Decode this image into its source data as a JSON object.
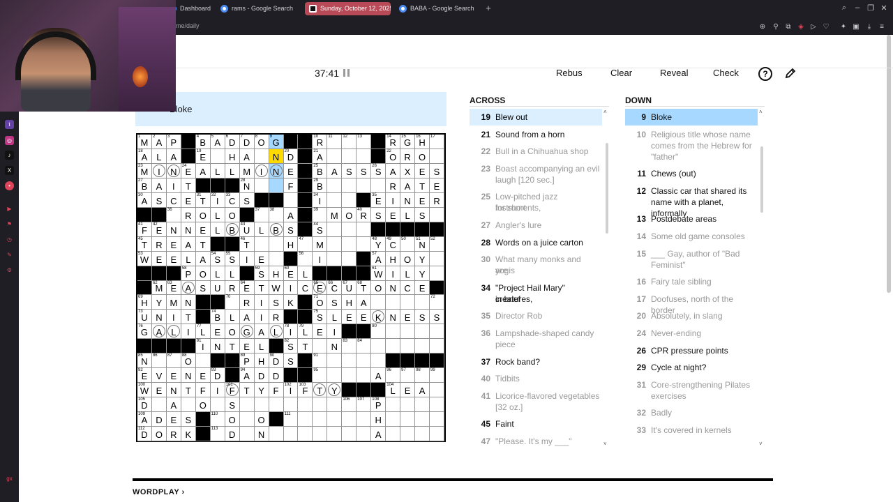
{
  "browser": {
    "tabs": [
      {
        "label": "Dashboard",
        "active": false
      },
      {
        "label": "rams - Google Search",
        "active": false
      },
      {
        "label": "Sunday, October 12, 2025",
        "active": true
      },
      {
        "label": "BABA - Google Search",
        "active": false
      }
    ],
    "url": "me/daily"
  },
  "toolbar": {
    "timer": "37:41",
    "rebus": "Rebus",
    "clear": "Clear",
    "reveal": "Reveal",
    "check": "Check",
    "help": "?"
  },
  "clue_bar": {
    "text": "Bloke"
  },
  "grid": {
    "rows": [
      "MAP#BADDOG##R##ARGH",
      "ALA#E.HA..D#A###TORO",
      "MINEALLMINE#BASSSAXES",
      "BAIT###N.F.B.....RATE",
      "ASCETICS##.I.#REINER",
      "##ROLO###A##MORSELS",
      "FENNELBULBS#S#####",
      "TREAT##T##H.M#.YC.N",
      "WEELASSIE.#.I..AHOY",
      "###POLL#SHEL##.WILY",
      "#MEASURETWICECUTONCE#",
      "HYMN##RISK#OSHA#",
      "UNIT#BLAIR##SLEEKNESS",
      "GALILEOGALILEI##",
      "####INTEL#ST..N.",
      "N..O###PHDS#......",
      "EVENED#ADD####A",
      "WENTFIFTYFIFTY##FLEA",
      "D..A..O..S.......P..",
      "ADES#.O..O....H.",
      "DORK#.D..N.......A.."
    ],
    "letters": [
      [
        "M",
        "A",
        "P",
        "#",
        "B",
        "A",
        "D",
        "D",
        "O",
        "G",
        "#",
        "#",
        "R",
        "",
        "",
        "#",
        "A",
        "R",
        "G",
        "H"
      ],
      [
        "A",
        "L",
        "A",
        "#",
        "E",
        "",
        "H",
        "A",
        "",
        "N",
        "D",
        "#",
        "A",
        "",
        "",
        "#",
        "T",
        "O",
        "R",
        "O"
      ],
      [
        "M",
        "I",
        "N",
        "E",
        "A",
        "L",
        "L",
        "M",
        "I",
        "N",
        "E",
        "#",
        "B",
        "A",
        "S",
        "S",
        "S",
        "A",
        "X",
        "E",
        "S"
      ],
      [
        "B",
        "A",
        "I",
        "T",
        "#",
        "#",
        "#",
        "N",
        "",
        "",
        "F",
        "",
        "B",
        "",
        "",
        "",
        "",
        "R",
        "A",
        "T",
        "E"
      ],
      [
        "A",
        "S",
        "C",
        "E",
        "T",
        "I",
        "C",
        "S",
        "#",
        "#",
        "",
        "#",
        "I",
        "",
        "#",
        "R",
        "E",
        "I",
        "N",
        "E",
        "R"
      ],
      [
        "#",
        "#",
        "",
        "R",
        "O",
        "L",
        "O",
        "#",
        "",
        "",
        "A",
        "#",
        "",
        "M",
        "O",
        "R",
        "S",
        "E",
        "L",
        "S",
        ""
      ],
      [
        "F",
        "E",
        "N",
        "N",
        "E",
        "L",
        "B",
        "U",
        "L",
        "B",
        "S",
        "#",
        "S",
        "",
        "",
        "#",
        "#",
        "#",
        "#",
        "#"
      ],
      [
        "T",
        "R",
        "E",
        "A",
        "T",
        "#",
        "#",
        "T",
        "",
        "",
        "H",
        "",
        "M",
        "",
        "",
        "",
        "Y",
        "C",
        "",
        "N"
      ],
      [
        "W",
        "E",
        "E",
        "L",
        "A",
        "S",
        "S",
        "I",
        "E",
        "",
        "#",
        "",
        "I",
        "",
        "",
        "#",
        "A",
        "H",
        "O",
        "Y"
      ],
      [
        "#",
        "#",
        "#",
        "P",
        "O",
        "L",
        "L",
        "#",
        "S",
        "H",
        "E",
        "L",
        "#",
        "#",
        "#",
        "#",
        "W",
        "I",
        "L",
        "Y"
      ],
      [
        "#",
        "M",
        "E",
        "A",
        "S",
        "U",
        "R",
        "E",
        "T",
        "W",
        "I",
        "C",
        "E",
        "C",
        "U",
        "T",
        "O",
        "N",
        "C",
        "E",
        "#"
      ],
      [
        "H",
        "Y",
        "M",
        "N",
        "#",
        "#",
        "",
        "R",
        "I",
        "S",
        "K",
        "#",
        "O",
        "S",
        "H",
        "A",
        "",
        "",
        "",
        "",
        ""
      ],
      [
        "U",
        "N",
        "I",
        "T",
        "#",
        "B",
        "L",
        "A",
        "I",
        "R",
        "#",
        "#",
        "S",
        "L",
        "E",
        "E",
        "K",
        "N",
        "E",
        "S",
        "S"
      ],
      [
        "G",
        "A",
        "L",
        "I",
        "L",
        "E",
        "O",
        "G",
        "A",
        "L",
        "I",
        "L",
        "E",
        "I",
        "#",
        "#",
        "",
        "",
        "",
        ""
      ],
      [
        "#",
        "#",
        "#",
        "#",
        "I",
        "N",
        "T",
        "E",
        "L",
        "#",
        "S",
        "T",
        "",
        "N",
        "",
        "",
        "",
        "",
        "",
        ""
      ],
      [
        "N",
        "",
        "",
        "O",
        "",
        "#",
        "#",
        "P",
        "H",
        "D",
        "S",
        "#",
        "",
        "",
        "",
        "",
        "#",
        "#",
        "#",
        "#"
      ],
      [
        "E",
        "V",
        "E",
        "N",
        "E",
        "D",
        "#",
        "A",
        "D",
        "D",
        "#",
        "",
        "",
        "",
        "",
        "",
        "A",
        "",
        "",
        ""
      ],
      [
        "W",
        "E",
        "N",
        "T",
        "F",
        "I",
        "F",
        "T",
        "Y",
        "F",
        "I",
        "F",
        "T",
        "Y",
        "#",
        "#",
        "F",
        "L",
        "E",
        "A"
      ],
      [
        "D",
        "",
        "A",
        "",
        "O",
        "",
        "S",
        "",
        "",
        "",
        "",
        "",
        "",
        "",
        "",
        "",
        "P",
        "",
        "",
        ""
      ],
      [
        "A",
        "D",
        "E",
        "S",
        "#",
        "",
        "O",
        "",
        "O",
        "",
        "",
        "",
        "",
        "",
        "",
        "",
        "H",
        "",
        "",
        ""
      ],
      [
        "D",
        "O",
        "R",
        "K",
        "#",
        "",
        "D",
        "",
        "N",
        "",
        "",
        "",
        "",
        "",
        "",
        "",
        "A",
        "",
        "",
        ""
      ]
    ],
    "numbers": [
      [
        [
          "0",
          "0",
          "1"
        ],
        [
          "0",
          "1",
          "2"
        ],
        [
          "0",
          "2",
          "3"
        ],
        [
          "0",
          "4",
          "4"
        ],
        [
          "0",
          "5",
          "5"
        ],
        [
          "0",
          "6",
          "6"
        ],
        [
          "0",
          "7",
          "7"
        ],
        [
          "0",
          "8",
          "8"
        ],
        [
          "0",
          "9",
          "9"
        ],
        [
          "0",
          "12",
          "10"
        ],
        [
          "0",
          "13",
          "11"
        ],
        [
          "0",
          "14",
          "12"
        ],
        [
          "0",
          "15",
          "13"
        ],
        [
          "0",
          "17",
          "14"
        ],
        [
          "0",
          "18",
          "15"
        ],
        [
          "0",
          "19",
          "16"
        ],
        [
          "0",
          "20",
          "17"
        ]
      ],
      [
        [
          "1",
          "0",
          "18"
        ],
        [
          "1",
          "4",
          "19"
        ],
        [
          "1",
          "10",
          "20"
        ],
        [
          "1",
          "12",
          "21"
        ],
        [
          "1",
          "17",
          "22"
        ]
      ]
    ]
  },
  "across": {
    "title": "ACROSS",
    "clues": [
      {
        "n": "19",
        "t": "Blew out",
        "state": "cross"
      },
      {
        "n": "21",
        "t": "Sound from a horn",
        "state": "live"
      },
      {
        "n": "22",
        "t": "Bull in a Chihuahua shop",
        "state": "done"
      },
      {
        "n": "23",
        "t": "Boast accompanying an evil",
        "t2": "laugh [120 sec.]",
        "state": "done"
      },
      {
        "n": "25",
        "t": "Low-pitched jazz instruments,",
        "t2": "for short",
        "state": "done"
      },
      {
        "n": "27",
        "t": "Angler's lure",
        "state": "done"
      },
      {
        "n": "28",
        "t": "Words on a juice carton",
        "state": "live"
      },
      {
        "n": "30",
        "t": "What many monks and yogis",
        "t2": "are",
        "state": "done"
      },
      {
        "n": "34",
        "t": "\"Project Hail Mary\" creatures,",
        "t2": "in brief",
        "state": "live"
      },
      {
        "n": "35",
        "t": "Director Rob",
        "state": "done"
      },
      {
        "n": "36",
        "t": "Lampshade-shaped candy",
        "t2": "piece",
        "state": "done"
      },
      {
        "n": "37",
        "t": "Rock band?",
        "state": "live"
      },
      {
        "n": "40",
        "t": "Tidbits",
        "state": "done"
      },
      {
        "n": "41",
        "t": "Licorice-flavored vegetables",
        "t2": "[32 oz.]",
        "state": "done"
      },
      {
        "n": "45",
        "t": "Faint",
        "state": "live"
      },
      {
        "n": "47",
        "t": "\"Please. It's my ___\"",
        "state": "done"
      }
    ]
  },
  "down": {
    "title": "DOWN",
    "clues": [
      {
        "n": "9",
        "t": "Bloke",
        "state": "hl"
      },
      {
        "n": "10",
        "t": "Religious title whose name",
        "t2": "comes from the Hebrew for",
        "t3": "\"father\"",
        "state": "done"
      },
      {
        "n": "11",
        "t": "Chews (out)",
        "state": "live"
      },
      {
        "n": "12",
        "t": "Classic car that shared its",
        "t2": "name with a planet, informally",
        "state": "live"
      },
      {
        "n": "13",
        "t": "Postdebate areas",
        "state": "live"
      },
      {
        "n": "14",
        "t": "Some old game consoles",
        "state": "done"
      },
      {
        "n": "15",
        "t": "___ Gay, author of \"Bad",
        "t2": "Feminist\"",
        "state": "done"
      },
      {
        "n": "16",
        "t": "Fairy tale sibling",
        "state": "done"
      },
      {
        "n": "17",
        "t": "Doofuses, north of the border",
        "state": "done"
      },
      {
        "n": "20",
        "t": "Absolutely, in slang",
        "state": "done"
      },
      {
        "n": "24",
        "t": "Never-ending",
        "state": "done"
      },
      {
        "n": "26",
        "t": "CPR pressure points",
        "state": "live"
      },
      {
        "n": "29",
        "t": "Cycle at night?",
        "state": "live"
      },
      {
        "n": "31",
        "t": "Core-strengthening Pilates",
        "t2": "exercises",
        "state": "done"
      },
      {
        "n": "32",
        "t": "Badly",
        "state": "done"
      },
      {
        "n": "33",
        "t": "It's covered in kernels",
        "state": "done"
      }
    ]
  },
  "footer": {
    "wordplay": "WORDPLAY ›"
  }
}
